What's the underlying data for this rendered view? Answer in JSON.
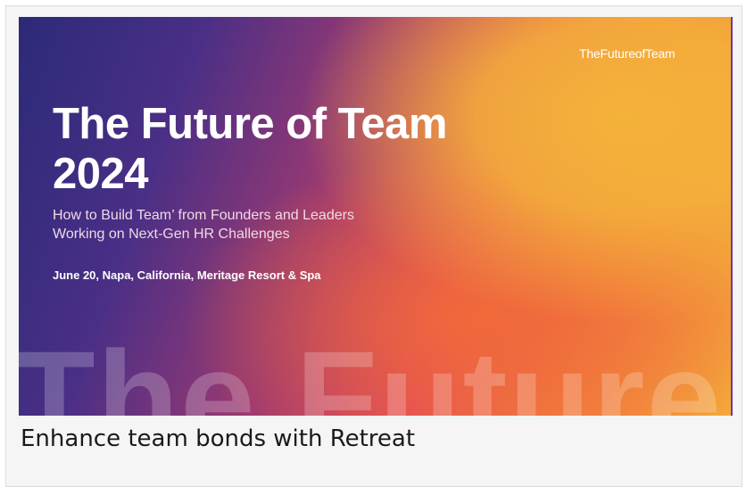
{
  "banner": {
    "brand": "TheFutureofTeam",
    "title_line1": "The Future of Team",
    "title_line2": "2024",
    "subtitle_line1": "How to Build Team’ from Founders and Leaders",
    "subtitle_line2": "Working on Next-Gen HR Challenges",
    "event_details": "June 20, Napa, California, Meritage Resort & Spa",
    "watermark_text": "The Future"
  },
  "caption": "Enhance team bonds with Retreat"
}
